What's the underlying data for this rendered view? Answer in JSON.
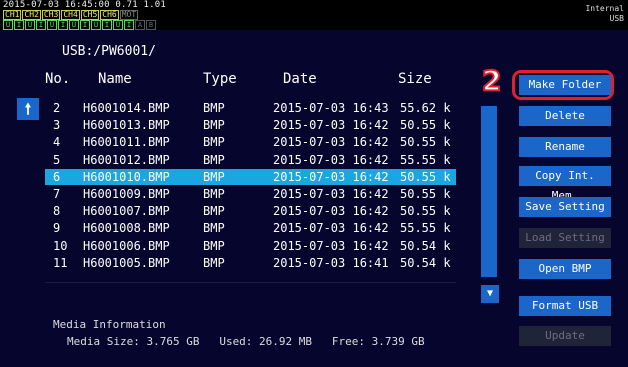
{
  "status": {
    "timestamp": "2015-07-03 16:45:00 0.71 1.01",
    "channels": [
      "CH1",
      "CH2",
      "CH3",
      "CH4",
      "CH5",
      "CH6",
      "MOT"
    ],
    "io_flags": [
      "U",
      "I",
      "U",
      "I",
      "U",
      "I",
      "U",
      "I",
      "U",
      "I",
      "U",
      "I",
      "A",
      "B"
    ],
    "storage": [
      "Internal",
      "USB"
    ]
  },
  "browser": {
    "path": "USB:/PW6001/",
    "columns": {
      "no": "No.",
      "name": "Name",
      "type": "Type",
      "date": "Date",
      "size": "Size"
    },
    "rows": [
      {
        "no": "2",
        "name": "H6001014.BMP",
        "type": "BMP",
        "date": "2015-07-03 16:43",
        "size": "55.62 k"
      },
      {
        "no": "3",
        "name": "H6001013.BMP",
        "type": "BMP",
        "date": "2015-07-03 16:42",
        "size": "50.55 k"
      },
      {
        "no": "4",
        "name": "H6001011.BMP",
        "type": "BMP",
        "date": "2015-07-03 16:42",
        "size": "50.55 k"
      },
      {
        "no": "5",
        "name": "H6001012.BMP",
        "type": "BMP",
        "date": "2015-07-03 16:42",
        "size": "55.55 k"
      },
      {
        "no": "6",
        "name": "H6001010.BMP",
        "type": "BMP",
        "date": "2015-07-03 16:42",
        "size": "50.55 k",
        "selected": true
      },
      {
        "no": "7",
        "name": "H6001009.BMP",
        "type": "BMP",
        "date": "2015-07-03 16:42",
        "size": "50.55 k"
      },
      {
        "no": "8",
        "name": "H6001007.BMP",
        "type": "BMP",
        "date": "2015-07-03 16:42",
        "size": "50.55 k"
      },
      {
        "no": "9",
        "name": "H6001008.BMP",
        "type": "BMP",
        "date": "2015-07-03 16:42",
        "size": "55.55 k"
      },
      {
        "no": "10",
        "name": "H6001006.BMP",
        "type": "BMP",
        "date": "2015-07-03 16:42",
        "size": "50.54 k"
      },
      {
        "no": "11",
        "name": "H6001005.BMP",
        "type": "BMP",
        "date": "2015-07-03 16:41",
        "size": "50.54 k"
      }
    ]
  },
  "media": {
    "title": "Media Information",
    "line": "Media Size: 3.765 GB   Used: 26.92 MB   Free: 3.739 GB"
  },
  "buttons": {
    "make_folder": "Make Folder",
    "delete": "Delete",
    "rename": "Rename",
    "copy_int_mem": "Copy Int. Mem.",
    "save_setting": "Save Setting",
    "load_setting": "Load Setting",
    "open_bmp": "Open BMP",
    "format_usb": "Format USB",
    "update": "Update"
  },
  "callout": "2",
  "icons": {
    "up": "arrow-up-icon",
    "down": "arrow-down-icon"
  },
  "colors": {
    "accent": "#1a66c9",
    "selected": "#1aa6e0",
    "highlight": "#e0202e",
    "background": "#05052e"
  }
}
